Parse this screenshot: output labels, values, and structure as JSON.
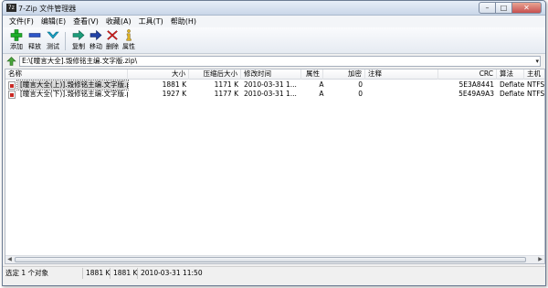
{
  "window": {
    "title": "7-Zip 文件管理器",
    "icon_text": "7z",
    "controls": {
      "minimize": "–",
      "maximize": "□",
      "close": "✕"
    }
  },
  "menu": [
    "文件(F)",
    "编辑(E)",
    "查看(V)",
    "收藏(A)",
    "工具(T)",
    "帮助(H)"
  ],
  "toolbar": {
    "buttons": [
      {
        "label": "添加",
        "icon": "add-icon",
        "color": "#1fae2a"
      },
      {
        "label": "释放",
        "icon": "extract-icon",
        "color": "#2d55c8"
      },
      {
        "label": "测试",
        "icon": "test-icon",
        "color": "#1aa5c9"
      },
      {
        "label": "复制",
        "icon": "copy-icon",
        "color": "#1c9c7a"
      },
      {
        "label": "移动",
        "icon": "move-icon",
        "color": "#2142a6"
      },
      {
        "label": "删除",
        "icon": "delete-icon",
        "color": "#d21f1f"
      },
      {
        "label": "属性",
        "icon": "info-icon",
        "color": "#e0b421"
      }
    ]
  },
  "address": {
    "path": "E:\\[瞳言大全].毁修铭主编.文字版.zip\\",
    "dropdown": "▾"
  },
  "columns": [
    "名称",
    "大小",
    "压缩后大小",
    "修改时间",
    "属性",
    "加密",
    "注释",
    "CRC",
    "算法",
    "主机"
  ],
  "rows": [
    {
      "name": "[瞳言大全(上)].毁修铭主编.文字版.pdf",
      "size": "1881 K",
      "packed": "1171 K",
      "modified": "2010-03-31 1...",
      "attr": "A",
      "encrypted": "0",
      "comment": "",
      "crc": "5E3A8441",
      "method": "Deflate",
      "host": "NTFS",
      "selected": true
    },
    {
      "name": "[瞳言大全(下)].毁修铭主编.文字版.pdf",
      "size": "1927 K",
      "packed": "1177 K",
      "modified": "2010-03-31 1...",
      "attr": "A",
      "encrypted": "0",
      "comment": "",
      "crc": "5E49A9A3",
      "method": "Deflate",
      "host": "NTFS",
      "selected": false
    }
  ],
  "status": {
    "selection": "选定 1 个对象",
    "size": "1881 K",
    "packed": "1881 K",
    "modified": "2010-03-31 11:50"
  },
  "colors": {
    "selection_bg": "#d9d9d9",
    "close_button": "#c75050"
  }
}
